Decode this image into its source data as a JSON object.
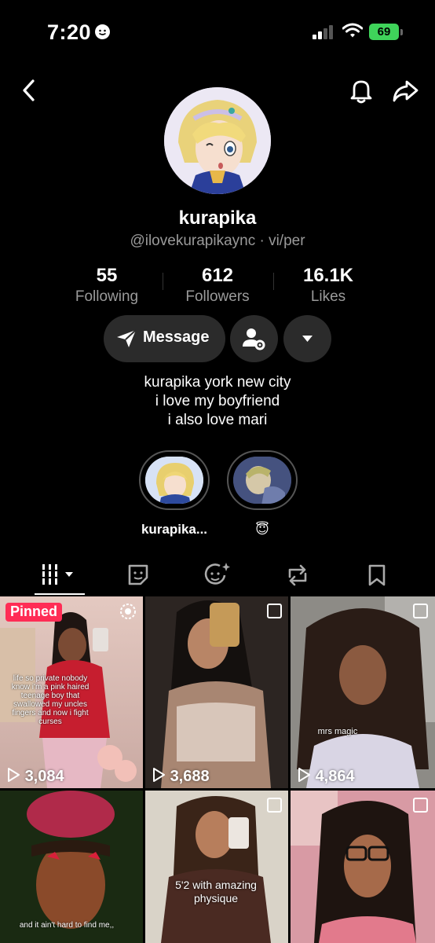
{
  "status_bar": {
    "time": "7:20",
    "battery": "69"
  },
  "profile": {
    "display_name": "kurapika",
    "handle": "@ilovekurapikaync · vi/per",
    "stats": [
      {
        "value": "55",
        "label": "Following"
      },
      {
        "value": "612",
        "label": "Followers"
      },
      {
        "value": "16.1K",
        "label": "Likes"
      }
    ],
    "message_label": "Message",
    "bio": [
      "kurapika york new city",
      "i love my boyfriend",
      "i also love mari"
    ]
  },
  "highlights": [
    {
      "label": "kurapika..."
    },
    {
      "label": "😇"
    }
  ],
  "tabs": [
    "videos-tab",
    "favorites-tab",
    "liked-tab",
    "reposts-tab",
    "saved-tab"
  ],
  "grid": {
    "pinned_label": "Pinned",
    "items": [
      {
        "views": "3,084",
        "overlay": "life so private nobody know i'm a pink haired teenage boy that swallowed my uncles fingers and now i fight curses"
      },
      {
        "views": "3,688"
      },
      {
        "views": "4,864",
        "overlay": "mrs magic"
      },
      {
        "views": "",
        "overlay": "and it ain't hard to find me,,"
      },
      {
        "views": "",
        "overlay": "5'2 with amazing physique"
      },
      {
        "views": ""
      }
    ]
  },
  "colors": {
    "pinned": "#ff2c55",
    "battery": "#3fd35a",
    "background": "#000000"
  }
}
